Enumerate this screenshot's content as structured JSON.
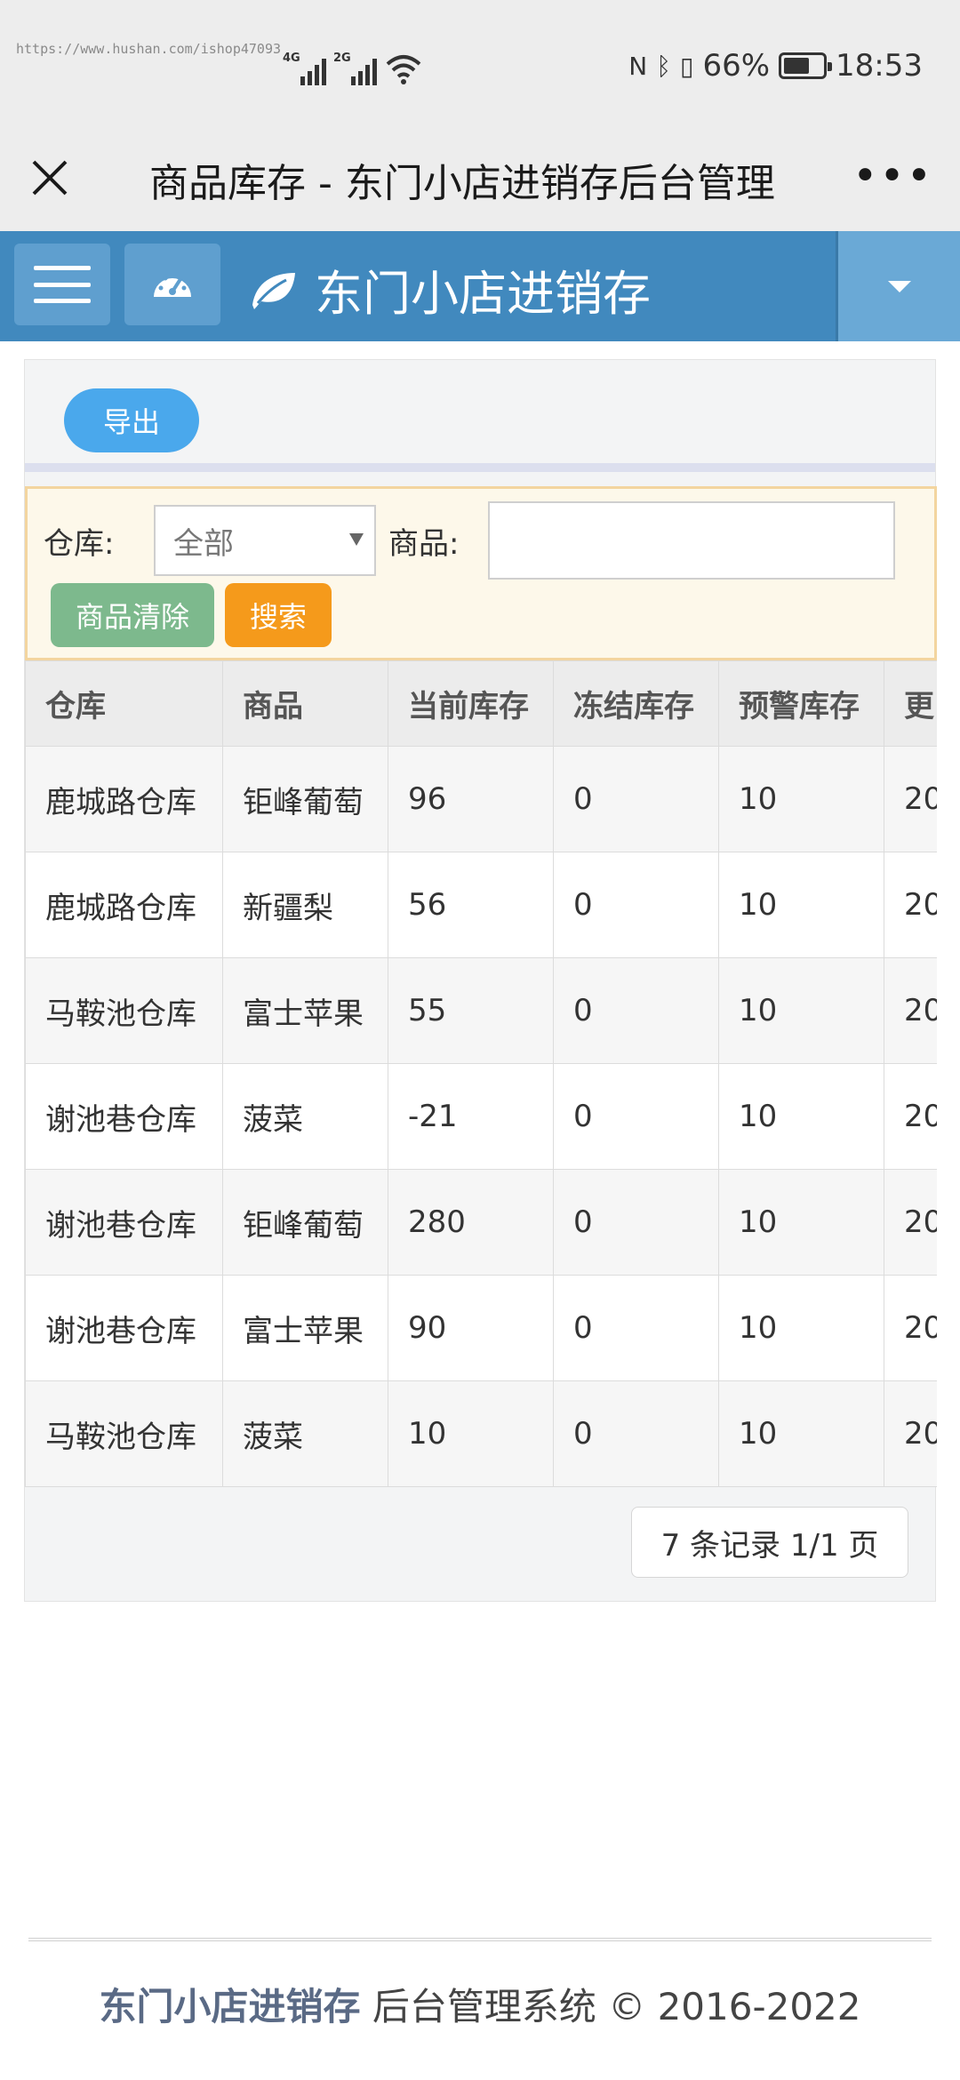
{
  "status_bar": {
    "watermark": "https://www.hushan.com/ishop47093",
    "signal1": "4G",
    "signal2": "2G",
    "battery": "66%",
    "battery_level": 0.66,
    "time": "18:53",
    "nfc_glyph": "N",
    "bluetooth_glyph": "ᛒ",
    "vibrate_glyph": "▯"
  },
  "titlebar": {
    "title": "商品库存 - 东门小店进销存后台管理",
    "more": "•••"
  },
  "header": {
    "brand": "东门小店进销存"
  },
  "toolbar": {
    "export": "导出"
  },
  "filter": {
    "warehouse_label": "仓库:",
    "warehouse_value": "全部",
    "goods_label": "商品:",
    "goods_value": "",
    "clear_label": "商品清除",
    "search_label": "搜索"
  },
  "table": {
    "headers": [
      "仓库",
      "商品",
      "当前库存",
      "冻结库存",
      "预警库存",
      "更"
    ],
    "rows": [
      [
        "鹿城路仓库",
        "钜峰葡萄",
        "96",
        "0",
        "10",
        "20"
      ],
      [
        "鹿城路仓库",
        "新疆梨",
        "56",
        "0",
        "10",
        "20"
      ],
      [
        "马鞍池仓库",
        "富士苹果",
        "55",
        "0",
        "10",
        "20"
      ],
      [
        "谢池巷仓库",
        "菠菜",
        "-21",
        "0",
        "10",
        "20"
      ],
      [
        "谢池巷仓库",
        "钜峰葡萄",
        "280",
        "0",
        "10",
        "20"
      ],
      [
        "谢池巷仓库",
        "富士苹果",
        "90",
        "0",
        "10",
        "20"
      ],
      [
        "马鞍池仓库",
        "菠菜",
        "10",
        "0",
        "10",
        "20"
      ]
    ]
  },
  "pager": {
    "text": "7 条记录 1/1 页"
  },
  "footer": {
    "brand": "东门小店进销存",
    "text": " 后台管理系统 © 2016-2022"
  },
  "colors": {
    "header_bg": "#4189be",
    "export_btn": "#4aa8ec",
    "clear_btn": "#7db98d",
    "search_btn": "#f59a1b",
    "filter_bg": "#fdf8ea"
  },
  "icons": {
    "close": "close-icon",
    "more": "more-icon",
    "menu": "hamburger-icon",
    "dashboard": "dashboard-icon",
    "brand": "leaf-icon",
    "dropdown": "caret-down-icon"
  }
}
